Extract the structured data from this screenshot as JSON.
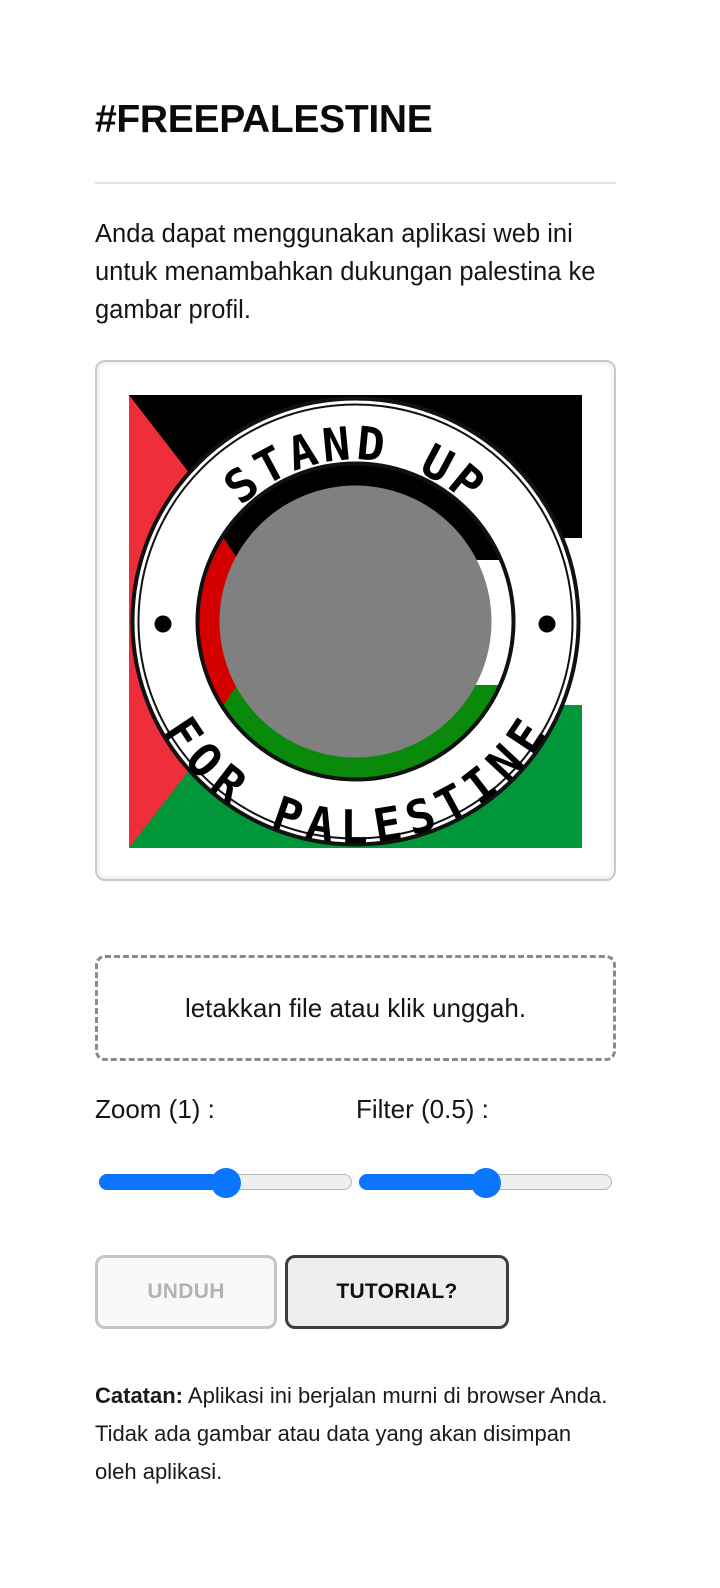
{
  "header": {
    "title": "#FREEPALESTINE"
  },
  "intro": {
    "text": "Anda dapat menggunakan aplikasi web ini untuk menambahkan dukungan palestina ke gambar profil."
  },
  "preview": {
    "badge_top_text": "STAND UP",
    "badge_bottom_text": "FOR PALESTINE",
    "colors": {
      "red": "#ee2e3a",
      "black": "#000000",
      "white": "#ffffff",
      "green": "#009639",
      "ring_red": "#d40000",
      "ring_green": "#0a8a0a",
      "placeholder": "#808080"
    }
  },
  "upload": {
    "label": "letakkan file atau klik unggah."
  },
  "controls": {
    "zoom_label": "Zoom (1) :",
    "filter_label": "Filter (0.5) :",
    "zoom_value_fraction": 0.5,
    "filter_value_fraction": 0.5,
    "accent_color": "#0a76ff"
  },
  "buttons": {
    "download_label": "UNDUH",
    "tutorial_label": "TUTORIAL?"
  },
  "note": {
    "label": "Catatan:",
    "text": " Aplikasi ini berjalan murni di browser Anda. Tidak ada gambar atau data yang akan disimpan oleh aplikasi."
  }
}
